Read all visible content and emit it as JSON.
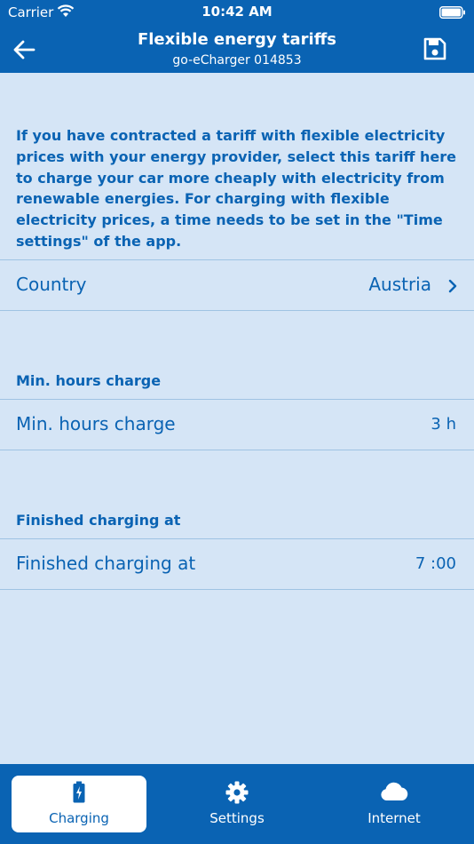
{
  "status_bar": {
    "carrier": "Carrier",
    "time": "10:42 AM"
  },
  "nav": {
    "title": "Flexible energy tariffs",
    "subtitle": "go-eCharger 014853"
  },
  "intro": "If you have contracted a tariff with flexible electricity prices with your energy provider, select this tariff here to charge your car more cheaply with electricity from renewable energies. For charging with flexible electricity prices, a time needs to be set in the \"Time settings\" of the app.",
  "country": {
    "label": "Country",
    "value": "Austria"
  },
  "min_hours": {
    "header": "Min. hours charge",
    "label": "Min. hours charge",
    "value": "3 h"
  },
  "finished": {
    "header": "Finished charging at",
    "label": "Finished charging at",
    "value": "7 :00"
  },
  "tabs": [
    {
      "label": "Charging",
      "icon": "battery-charging-icon",
      "active": true
    },
    {
      "label": "Settings",
      "icon": "gear-icon",
      "active": false
    },
    {
      "label": "Internet",
      "icon": "cloud-icon",
      "active": false
    }
  ],
  "colors": {
    "primary": "#0a63b3",
    "background": "#d5e5f6",
    "divider": "#9fc3e3"
  }
}
